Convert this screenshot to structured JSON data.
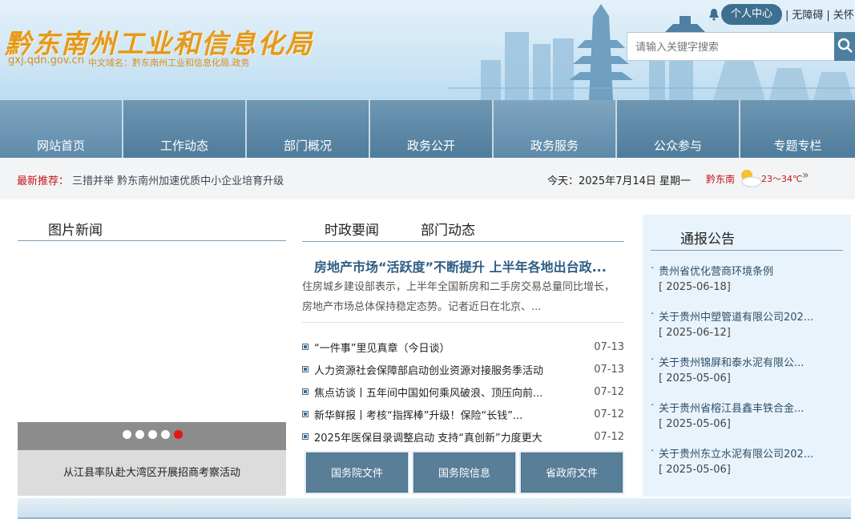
{
  "header": {
    "logo_title": "黔东南州工业和信息化局",
    "domain": "gxj.qdn.gov.cn",
    "cn_domain": "中文域名：黔东南州工业和信息化局.政务",
    "user_center": "个人中心",
    "accessibility": "无障碍",
    "care": "关怀",
    "search_placeholder": "请输入关键字搜索",
    "search_icon": "search-icon"
  },
  "nav": {
    "items": [
      "网站首页",
      "工作动态",
      "部门概况",
      "政务公开",
      "政务服务",
      "公众参与",
      "专题专栏"
    ]
  },
  "notice": {
    "label": "最新推荐：",
    "text": "三措并举  黔东南州加速优质中小企业培育升级",
    "date": "今天：2025年7月14日 星期一",
    "city": "黔东南",
    "temp": "23～34℃",
    "more": "»"
  },
  "pic_news": {
    "title": "图片新闻",
    "caption": "从江县率队赴大湾区开展招商考察活动",
    "slide_count": 5,
    "active_slide": 5
  },
  "news": {
    "tab_active": "时政要闻",
    "tab_other": "部门动态",
    "headline": "房地产市场“活跃度”不断提升 上半年各地出台政...",
    "summary": "住房城乡建设部表示，上半年全国新房和二手房交易总量同比增长，房地产市场总体保持稳定态势。记者近日在北京、...",
    "items": [
      {
        "title": "“一件事”里见真章（今日谈）",
        "date": "07-13"
      },
      {
        "title": "人力资源社会保障部启动创业资源对接服务季活动",
        "date": "07-13"
      },
      {
        "title": "焦点访谈丨五年间中国如何乘风破浪、顶压向前...",
        "date": "07-12"
      },
      {
        "title": "新华鲜报丨考核“指挥棒”升级！保险“长钱”...",
        "date": "07-12"
      },
      {
        "title": "2025年医保目录调整启动 支持“真创新”力度更大",
        "date": "07-12"
      }
    ],
    "buttons": [
      "国务院文件",
      "国务院信息",
      "省政府文件"
    ]
  },
  "announcements": {
    "title": "通报公告",
    "items": [
      {
        "title": "贵州省优化营商环境条例",
        "date": "[ 2025-06-18]"
      },
      {
        "title": "关于贵州中塑管道有限公司202...",
        "date": "[ 2025-06-12]"
      },
      {
        "title": "关于贵州锦屏和泰水泥有限公...",
        "date": "[ 2025-05-06]"
      },
      {
        "title": "关于贵州省榕江县鑫丰铁合金...",
        "date": "[ 2025-05-06]"
      },
      {
        "title": "关于贵州东立水泥有限公司202...",
        "date": "[ 2025-05-06]"
      }
    ]
  }
}
